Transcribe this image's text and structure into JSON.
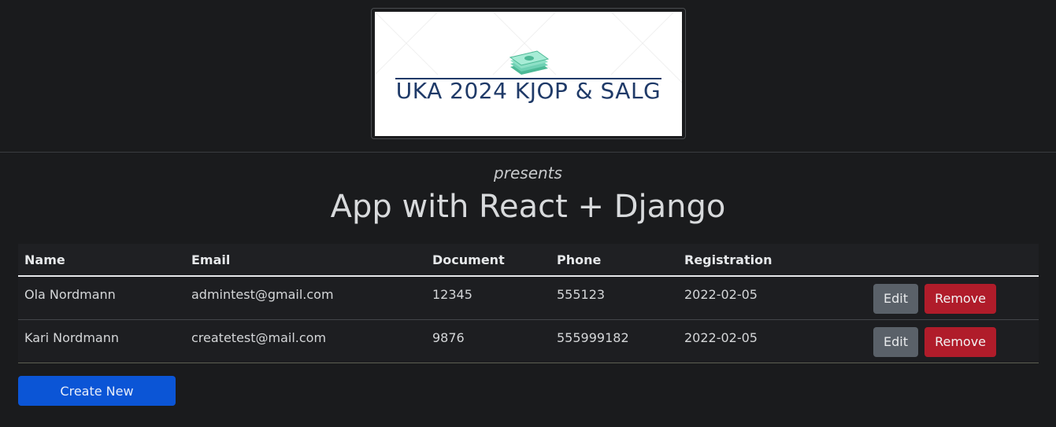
{
  "logo": {
    "text": "UKA 2024 KJOP & SALG",
    "accent_color": "#6fd1b4",
    "text_color": "#1f3a68"
  },
  "hero": {
    "presents": "presents",
    "title": "App with React + Django"
  },
  "table": {
    "headers": {
      "name": "Name",
      "email": "Email",
      "document": "Document",
      "phone": "Phone",
      "registration": "Registration"
    },
    "rows": [
      {
        "name": "Ola Nordmann",
        "email": "admintest@gmail.com",
        "document": "12345",
        "phone": "555123",
        "registration": "2022-02-05",
        "edit_label": "Edit",
        "remove_label": "Remove"
      },
      {
        "name": "Kari Nordmann",
        "email": "createtest@mail.com",
        "document": "9876",
        "phone": "555999182",
        "registration": "2022-02-05",
        "edit_label": "Edit",
        "remove_label": "Remove"
      }
    ]
  },
  "actions": {
    "create_label": "Create New"
  },
  "colors": {
    "background": "#1a1b1d",
    "edit_button": "#5a6169",
    "remove_button": "#b01c2a",
    "create_button": "#0b55d6"
  }
}
